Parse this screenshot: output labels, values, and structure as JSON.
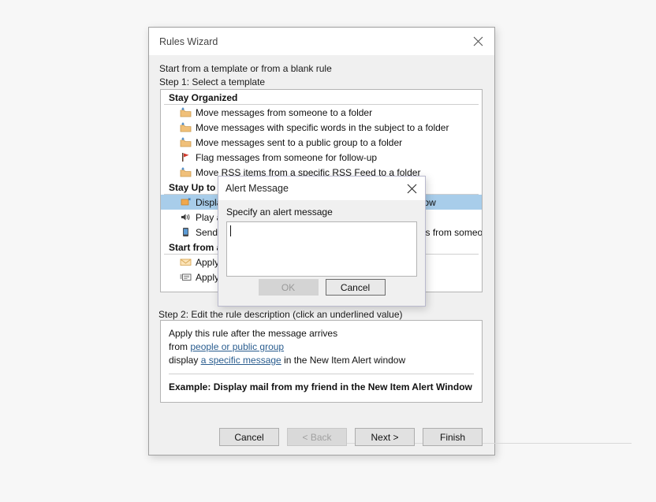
{
  "window": {
    "title": "Rules Wizard",
    "close_icon": "close-icon"
  },
  "intro": {
    "lead": "Start from a template or from a blank rule",
    "step1_label": "Step 1: Select a template"
  },
  "template_list": {
    "groups": [
      {
        "name": "Stay Organized",
        "items": [
          {
            "icon": "move-to-folder-icon",
            "label": "Move messages from someone to a folder",
            "selected": false
          },
          {
            "icon": "move-to-folder-icon",
            "label": "Move messages with specific words in the subject to a folder",
            "selected": false
          },
          {
            "icon": "move-to-folder-icon",
            "label": "Move messages sent to a public group to a folder",
            "selected": false
          },
          {
            "icon": "flag-icon",
            "label": "Flag messages from someone for follow-up",
            "selected": false
          },
          {
            "icon": "move-to-folder-icon",
            "label": "Move RSS items from a specific RSS Feed to a folder",
            "selected": false
          }
        ]
      },
      {
        "name": "Stay Up to Date",
        "items": [
          {
            "icon": "alert-window-icon",
            "label": "Display mail from someone in the New Item Alert Window",
            "selected": true
          },
          {
            "icon": "speaker-icon",
            "label": "Play a sound when I get messages from someone",
            "selected": false
          },
          {
            "icon": "mobile-device-icon",
            "label": "Send an alert to my mobile device when I get messages from someone",
            "selected": false
          }
        ]
      },
      {
        "name": "Start from a blank rule",
        "items": [
          {
            "icon": "envelope-icon",
            "label": "Apply rule on messages I receive",
            "selected": false
          },
          {
            "icon": "sent-message-icon",
            "label": "Apply rule on messages I send",
            "selected": false
          }
        ]
      }
    ]
  },
  "step2": {
    "label": "Step 2: Edit the rule description (click an underlined value)",
    "line1": "Apply this rule after the message arrives",
    "line2_prefix": "from ",
    "line2_link": "people or public group",
    "line3_prefix": "display ",
    "line3_link": "a specific message",
    "line3_suffix": " in the New Item Alert window",
    "example": "Example: Display mail from my friend in the New Item Alert Window"
  },
  "footer": {
    "cancel": "Cancel",
    "back": "< Back",
    "next": "Next >",
    "finish": "Finish"
  },
  "modal": {
    "title": "Alert Message",
    "close_icon": "close-icon",
    "field_label": "Specify an alert message",
    "field_value": "",
    "ok": "OK",
    "cancel": "Cancel"
  },
  "colors": {
    "selection_blue": "#a8cdea",
    "link_blue": "#2a5d8f",
    "dialog_bg": "#f0f0f0",
    "modal_border": "#b9b9cd",
    "folder_tan": "#f0c07a",
    "flag_red": "#d33a2c"
  }
}
